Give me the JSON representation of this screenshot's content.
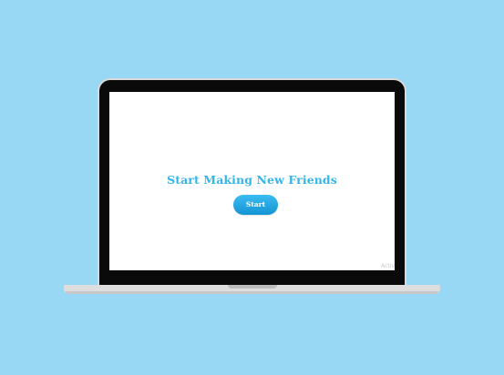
{
  "screen": {
    "title": "Start Making New Friends",
    "start_label": "Start",
    "watermark": "Activ"
  },
  "colors": {
    "background": "#98d8f4",
    "accent": "#35b5e8",
    "button": "#1ea6e2"
  },
  "icons": {
    "device": "laptop-icon"
  }
}
